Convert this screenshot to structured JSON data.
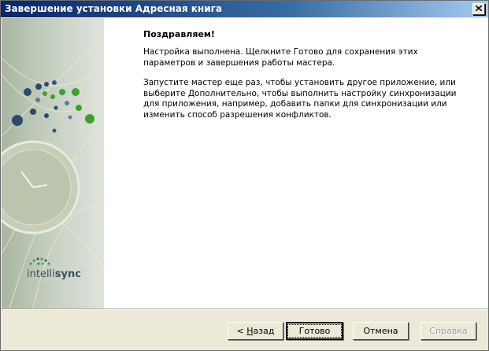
{
  "window": {
    "title": "Завершение установки Адресная книга"
  },
  "side_panel": {
    "logo_text_light": "intelli",
    "logo_text_bold": "sync"
  },
  "content": {
    "heading": "Поздравляем!",
    "paragraph1": "Настройка выполнена. Щелкните Готово для сохранения этих параметров и завершения работы мастера.",
    "paragraph2": "Запустите мастер еще раз, чтобы установить другое приложение, или выберите Дополнительно, чтобы выполнить настройку синхронизации для приложения, например, добавить папки для синхронизации или изменить способ разрешения конфликтов."
  },
  "buttons": {
    "back_prefix": "< ",
    "back_mnemonic": "Н",
    "back_rest": "азад",
    "finish": "Готово",
    "cancel": "Отмена",
    "help": "Справка"
  },
  "colors": {
    "title_start": "#0a246a",
    "title_end": "#a6caf0",
    "dialog_bg": "#ece9d8",
    "disabled_text": "#a0a0a0"
  }
}
